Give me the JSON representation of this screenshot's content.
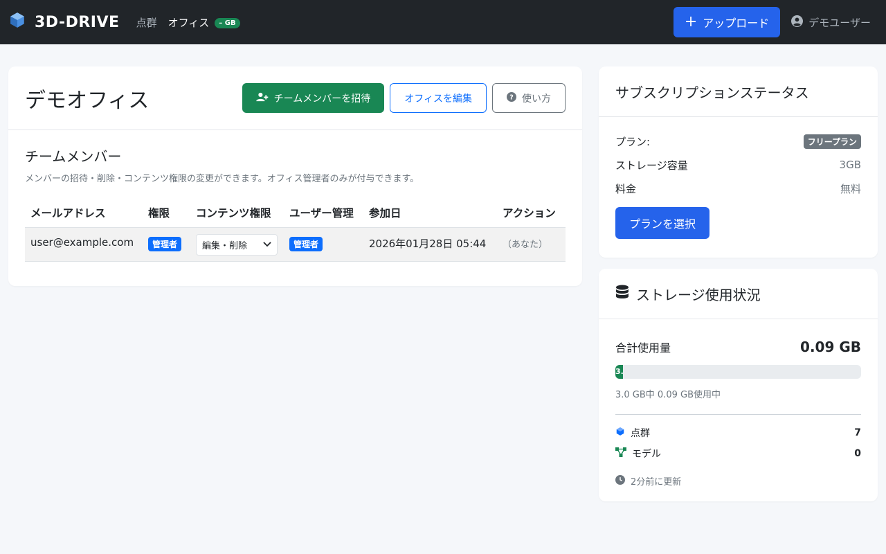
{
  "navbar": {
    "brand": "3D-DRIVE",
    "links": [
      "点群",
      "オフィス"
    ],
    "office_badge": "– GB",
    "upload_label": "アップロード",
    "user_name": "デモユーザー"
  },
  "office": {
    "title": "デモオフィス",
    "invite_label": "チームメンバーを招待",
    "edit_label": "オフィスを編集",
    "help_label": "使い方"
  },
  "members": {
    "title": "チームメンバー",
    "description": "メンバーの招待・削除・コンテンツ権限の変更ができます。オフィス管理者のみが付与できます。",
    "columns": [
      "メールアドレス",
      "権限",
      "コンテンツ権限",
      "ユーザー管理",
      "参加日",
      "アクション"
    ],
    "rows": [
      {
        "email": "user@example.com",
        "role": "管理者",
        "content_permission": "編集・削除",
        "user_management": "管理者",
        "joined": "2026年01月28日 05:44",
        "action": "（あなた）"
      }
    ]
  },
  "subscription": {
    "title": "サブスクリプションステータス",
    "plan_label": "プラン:",
    "plan_value": "フリープラン",
    "storage_label": "ストレージ容量",
    "storage_value": "3GB",
    "price_label": "料金",
    "price_value": "無料",
    "select_plan_label": "プランを選択"
  },
  "storage": {
    "title": "ストレージ使用状況",
    "total_label": "合計使用量",
    "total_value": "0.09 GB",
    "progress_text": "3.",
    "progress_fraction": 0.03,
    "usage_text": "3.0 GB中 0.09 GB使用中",
    "items": [
      {
        "label": "点群",
        "count": "7",
        "icon": "cube-icon"
      },
      {
        "label": "モデル",
        "count": "0",
        "icon": "model-icon"
      }
    ],
    "updated": "2分前に更新"
  },
  "colors": {
    "navbar_bg": "#212529",
    "primary": "#2563eb",
    "success": "#198754",
    "admin_badge": "#0d6efd",
    "plan_badge": "#6c757d"
  }
}
